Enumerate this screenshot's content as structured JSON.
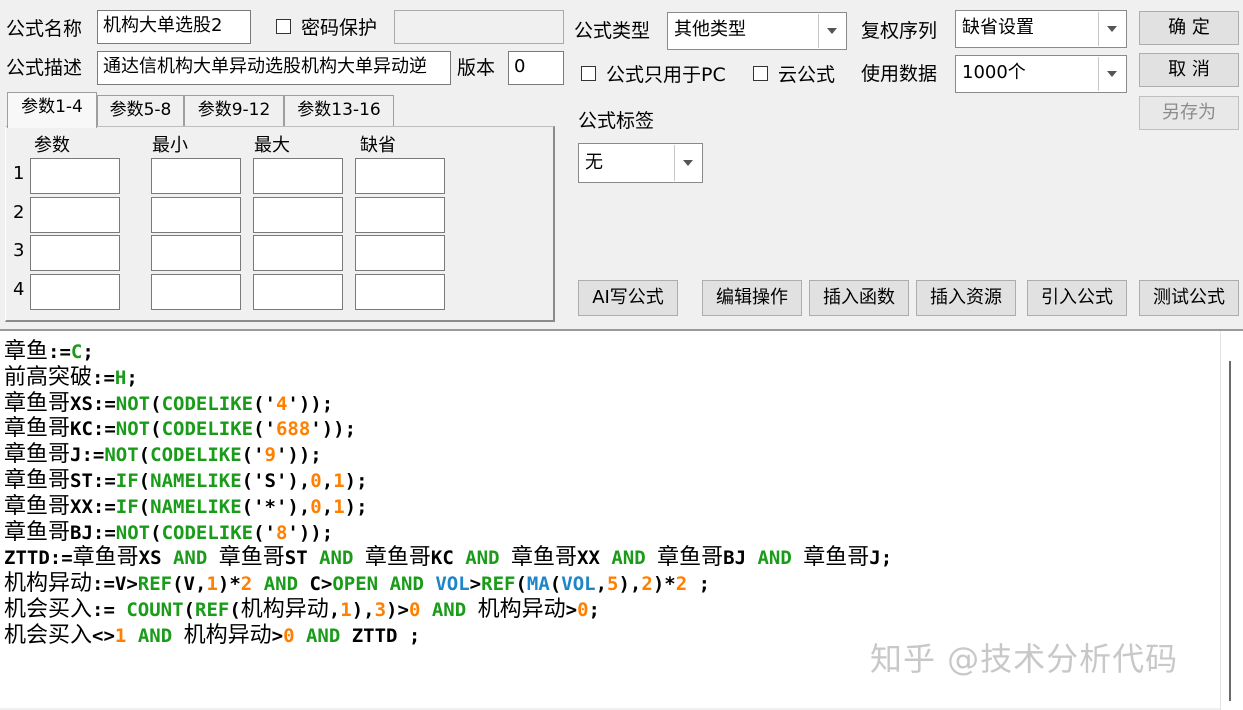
{
  "form": {
    "name_label": "公式名称",
    "name_value": "机构大单选股2",
    "password_label": "密码保护",
    "desc_label": "公式描述",
    "desc_value": "通达信机构大单异动选股机构大单异动逆",
    "version_label": "版本",
    "version_value": "0",
    "type_label": "公式类型",
    "type_value": "其他类型",
    "rights_label": "复权序列",
    "rights_value": "缺省设置",
    "pc_only_label": "公式只用于PC",
    "cloud_label": "云公式",
    "data_label": "使用数据",
    "data_value": "1000个",
    "tag_label": "公式标签",
    "tag_value": "无"
  },
  "buttons": {
    "ok": "确 定",
    "cancel": "取 消",
    "save_as": "另存为",
    "ai": "AI写公式",
    "edit_ops": "编辑操作",
    "insert_func": "插入函数",
    "insert_res": "插入资源",
    "import": "引入公式",
    "test": "测试公式"
  },
  "tabs": [
    "参数1-4",
    "参数5-8",
    "参数9-12",
    "参数13-16"
  ],
  "params": {
    "headers": [
      "参数",
      "最小",
      "最大",
      "缺省"
    ],
    "rows": [
      "1",
      "2",
      "3",
      "4"
    ]
  },
  "code_lines": [
    [
      {
        "t": "章鱼",
        "h": 1
      },
      {
        "t": ":="
      },
      {
        "t": "C",
        "c": "k"
      },
      {
        "t": ";"
      }
    ],
    [
      {
        "t": "前高突破",
        "h": 1
      },
      {
        "t": ":="
      },
      {
        "t": "H",
        "c": "k"
      },
      {
        "t": ";"
      }
    ],
    [
      {
        "t": "章鱼哥",
        "h": 1
      },
      {
        "t": "XS:="
      },
      {
        "t": "NOT",
        "c": "k"
      },
      {
        "t": "("
      },
      {
        "t": "CODELIKE",
        "c": "k"
      },
      {
        "t": "('"
      },
      {
        "t": "4",
        "c": "n"
      },
      {
        "t": "'));"
      }
    ],
    [
      {
        "t": "章鱼哥",
        "h": 1
      },
      {
        "t": "KC:="
      },
      {
        "t": "NOT",
        "c": "k"
      },
      {
        "t": "("
      },
      {
        "t": "CODELIKE",
        "c": "k"
      },
      {
        "t": "('"
      },
      {
        "t": "688",
        "c": "n"
      },
      {
        "t": "'));"
      }
    ],
    [
      {
        "t": "章鱼哥",
        "h": 1
      },
      {
        "t": "J:="
      },
      {
        "t": "NOT",
        "c": "k"
      },
      {
        "t": "("
      },
      {
        "t": "CODELIKE",
        "c": "k"
      },
      {
        "t": "('"
      },
      {
        "t": "9",
        "c": "n"
      },
      {
        "t": "'));"
      }
    ],
    [
      {
        "t": "章鱼哥",
        "h": 1
      },
      {
        "t": "ST:="
      },
      {
        "t": "IF",
        "c": "k"
      },
      {
        "t": "("
      },
      {
        "t": "NAMELIKE",
        "c": "k"
      },
      {
        "t": "('S'),"
      },
      {
        "t": "0",
        "c": "n"
      },
      {
        "t": ","
      },
      {
        "t": "1",
        "c": "n"
      },
      {
        "t": ");"
      }
    ],
    [
      {
        "t": "章鱼哥",
        "h": 1
      },
      {
        "t": "XX:="
      },
      {
        "t": "IF",
        "c": "k"
      },
      {
        "t": "("
      },
      {
        "t": "NAMELIKE",
        "c": "k"
      },
      {
        "t": "('*'),"
      },
      {
        "t": "0",
        "c": "n"
      },
      {
        "t": ","
      },
      {
        "t": "1",
        "c": "n"
      },
      {
        "t": ");"
      }
    ],
    [
      {
        "t": "章鱼哥",
        "h": 1
      },
      {
        "t": "BJ:="
      },
      {
        "t": "NOT",
        "c": "k"
      },
      {
        "t": "("
      },
      {
        "t": "CODELIKE",
        "c": "k"
      },
      {
        "t": "('"
      },
      {
        "t": "8",
        "c": "n"
      },
      {
        "t": "'));"
      }
    ],
    [
      {
        "t": "ZTTD:="
      },
      {
        "t": "章鱼哥",
        "h": 1
      },
      {
        "t": "XS "
      },
      {
        "t": "AND",
        "c": "k"
      },
      {
        "t": " "
      },
      {
        "t": "章鱼哥",
        "h": 1
      },
      {
        "t": "ST "
      },
      {
        "t": "AND",
        "c": "k"
      },
      {
        "t": " "
      },
      {
        "t": "章鱼哥",
        "h": 1
      },
      {
        "t": "KC "
      },
      {
        "t": "AND",
        "c": "k"
      },
      {
        "t": " "
      },
      {
        "t": "章鱼哥",
        "h": 1
      },
      {
        "t": "XX "
      },
      {
        "t": "AND",
        "c": "k"
      },
      {
        "t": " "
      },
      {
        "t": "章鱼哥",
        "h": 1
      },
      {
        "t": "BJ "
      },
      {
        "t": "AND",
        "c": "k"
      },
      {
        "t": " "
      },
      {
        "t": "章鱼哥",
        "h": 1
      },
      {
        "t": "J;"
      }
    ],
    [
      {
        "t": "机构异动",
        "h": 1
      },
      {
        "t": ":=V>"
      },
      {
        "t": "REF",
        "c": "k"
      },
      {
        "t": "(V,"
      },
      {
        "t": "1",
        "c": "n"
      },
      {
        "t": ")*"
      },
      {
        "t": "2",
        "c": "n"
      },
      {
        "t": " "
      },
      {
        "t": "AND",
        "c": "k"
      },
      {
        "t": " C>"
      },
      {
        "t": "OPEN",
        "c": "k"
      },
      {
        "t": " "
      },
      {
        "t": "AND",
        "c": "k"
      },
      {
        "t": " "
      },
      {
        "t": "VOL",
        "c": "b"
      },
      {
        "t": ">"
      },
      {
        "t": "REF",
        "c": "k"
      },
      {
        "t": "("
      },
      {
        "t": "MA",
        "c": "b"
      },
      {
        "t": "("
      },
      {
        "t": "VOL",
        "c": "b"
      },
      {
        "t": ","
      },
      {
        "t": "5",
        "c": "n"
      },
      {
        "t": "),"
      },
      {
        "t": "2",
        "c": "n"
      },
      {
        "t": ")*"
      },
      {
        "t": "2",
        "c": "n"
      },
      {
        "t": " ;"
      }
    ],
    [
      {
        "t": "机会买入",
        "h": 1
      },
      {
        "t": ":= "
      },
      {
        "t": "COUNT",
        "c": "k"
      },
      {
        "t": "("
      },
      {
        "t": "REF",
        "c": "k"
      },
      {
        "t": "("
      },
      {
        "t": "机构异动",
        "h": 1
      },
      {
        "t": ","
      },
      {
        "t": "1",
        "c": "n"
      },
      {
        "t": "),"
      },
      {
        "t": "3",
        "c": "n"
      },
      {
        "t": ")>"
      },
      {
        "t": "0",
        "c": "n"
      },
      {
        "t": " "
      },
      {
        "t": "AND",
        "c": "k"
      },
      {
        "t": " "
      },
      {
        "t": "机构异动",
        "h": 1
      },
      {
        "t": ">"
      },
      {
        "t": "0",
        "c": "n"
      },
      {
        "t": ";"
      }
    ],
    [
      {
        "t": "机会买入",
        "h": 1
      },
      {
        "t": "<>"
      },
      {
        "t": "1",
        "c": "n"
      },
      {
        "t": " "
      },
      {
        "t": "AND",
        "c": "k"
      },
      {
        "t": " "
      },
      {
        "t": "机构异动",
        "h": 1
      },
      {
        "t": ">"
      },
      {
        "t": "0",
        "c": "n"
      },
      {
        "t": " "
      },
      {
        "t": "AND",
        "c": "k"
      },
      {
        "t": " ZTTD ;"
      }
    ]
  ],
  "watermark": "知乎 @技术分析代码",
  "colors": {
    "keyword": "#1a9c1a",
    "number": "#ff7f00",
    "builtin": "#1e86c8"
  }
}
